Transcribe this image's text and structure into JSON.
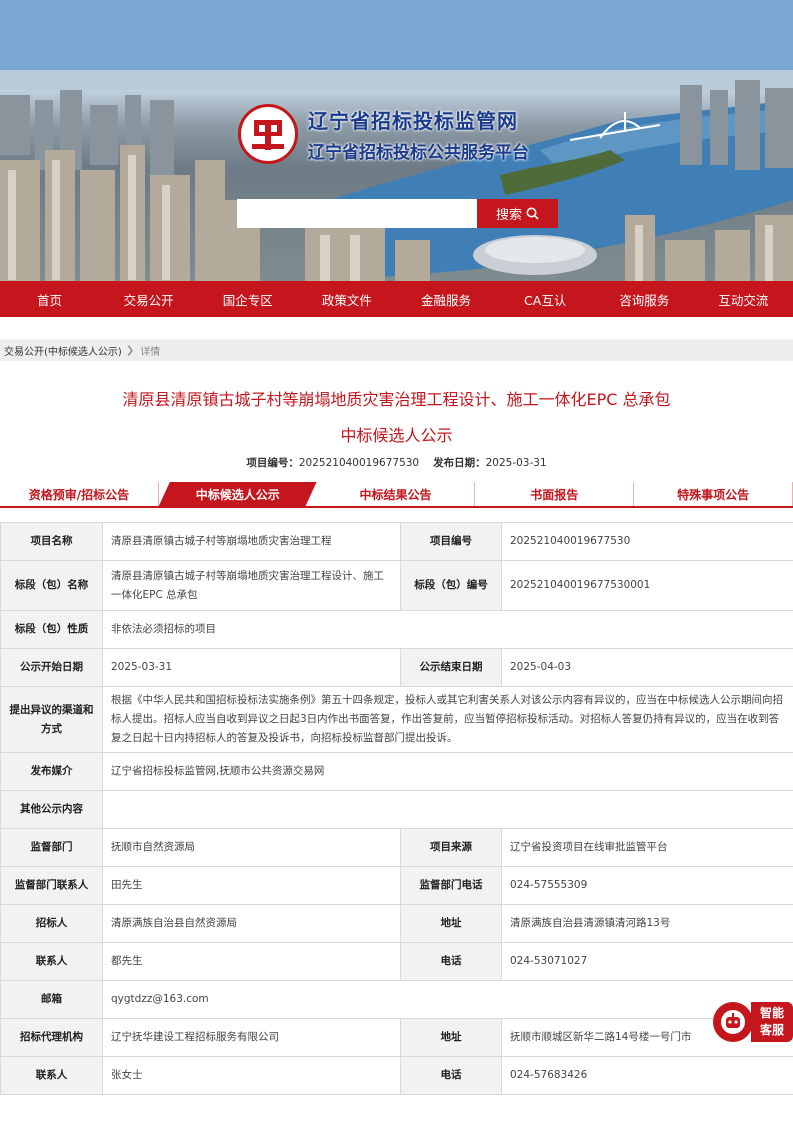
{
  "header": {
    "site_title": "辽宁省招标投标监管网",
    "site_subtitle": "辽宁省招标投标公共服务平台",
    "search_button": "搜索"
  },
  "nav": [
    "首页",
    "交易公开",
    "国企专区",
    "政策文件",
    "金融服务",
    "CA互认",
    "咨询服务",
    "互动交流"
  ],
  "breadcrumb": {
    "section": "交易公开(中标候选人公示)",
    "current": "详情"
  },
  "article": {
    "title_line1": "清原县清原镇古城子村等崩塌地质灾害治理工程设计、施工一体化EPC 总承包",
    "title_line2": "中标候选人公示",
    "project_no_label": "项目编号：",
    "project_no": "202521040019677530",
    "pub_date_label": "发布日期：",
    "pub_date": "2025-03-31"
  },
  "tabs": [
    {
      "label": "资格预审/招标公告",
      "active": false
    },
    {
      "label": "中标候选人公示",
      "active": true
    },
    {
      "label": "中标结果公告",
      "active": false
    },
    {
      "label": "书面报告",
      "active": false
    },
    {
      "label": "特殊事项公告",
      "active": false
    }
  ],
  "table": {
    "project_name_label": "项目名称",
    "project_name": "清原县清原镇古城子村等崩塌地质灾害治理工程",
    "project_code_label": "项目编号",
    "project_code": "202521040019677530",
    "section_name_label": "标段（包）名称",
    "section_name": "清原县清原镇古城子村等崩塌地质灾害治理工程设计、施工一体化EPC 总承包",
    "section_code_label": "标段（包）编号",
    "section_code": "202521040019677530001",
    "section_nature_label": "标段（包）性质",
    "section_nature": "非依法必须招标的项目",
    "start_date_label": "公示开始日期",
    "start_date": "2025-03-31",
    "end_date_label": "公示结束日期",
    "end_date": "2025-04-03",
    "objection_label": "提出异议的渠道和方式",
    "objection_text": "根据《中华人民共和国招标投标法实施条例》第五十四条规定，投标人或其它利害关系人对该公示内容有异议的，应当在中标候选人公示期间向招标人提出。招标人应当自收到异议之日起3日内作出书面答复，作出答复前，应当暂停招标投标活动。对招标人答复仍持有异议的，应当在收到答复之日起十日内持招标人的答复及投诉书，向招标投标监督部门提出投诉。",
    "media_label": "发布媒介",
    "media": "辽宁省招标投标监管网,抚顺市公共资源交易网",
    "other_label": "其他公示内容",
    "other": "",
    "supervisor_label": "监督部门",
    "supervisor": "抚顺市自然资源局",
    "source_label": "项目来源",
    "source": "辽宁省投资项目在线审批监管平台",
    "sup_contact_label": "监督部门联系人",
    "sup_contact": "田先生",
    "sup_phone_label": "监督部门电话",
    "sup_phone": "024-57555309",
    "tenderer_label": "招标人",
    "tenderer": "清原满族自治县自然资源局",
    "address_label": "地址",
    "address": "清原满族自治县清源镇清河路13号",
    "contact_label": "联系人",
    "contact": "都先生",
    "phone_label": "电话",
    "phone": "024-53071027",
    "email_label": "邮箱",
    "email": "qygtdzz@163.com",
    "agency_label": "招标代理机构",
    "agency": "辽宁抚华建设工程招标服务有限公司",
    "agency_address_label": "地址",
    "agency_address": "抚顺市顺城区新华二路14号楼一号门市",
    "agency_contact_label": "联系人",
    "agency_contact": "张女士",
    "agency_phone_label": "电话",
    "agency_phone": "024-57683426"
  },
  "service": {
    "line1": "智能",
    "line2": "客服"
  },
  "colors": {
    "brand_red": "#c4161c",
    "title_blue": "#1b3b8c"
  }
}
